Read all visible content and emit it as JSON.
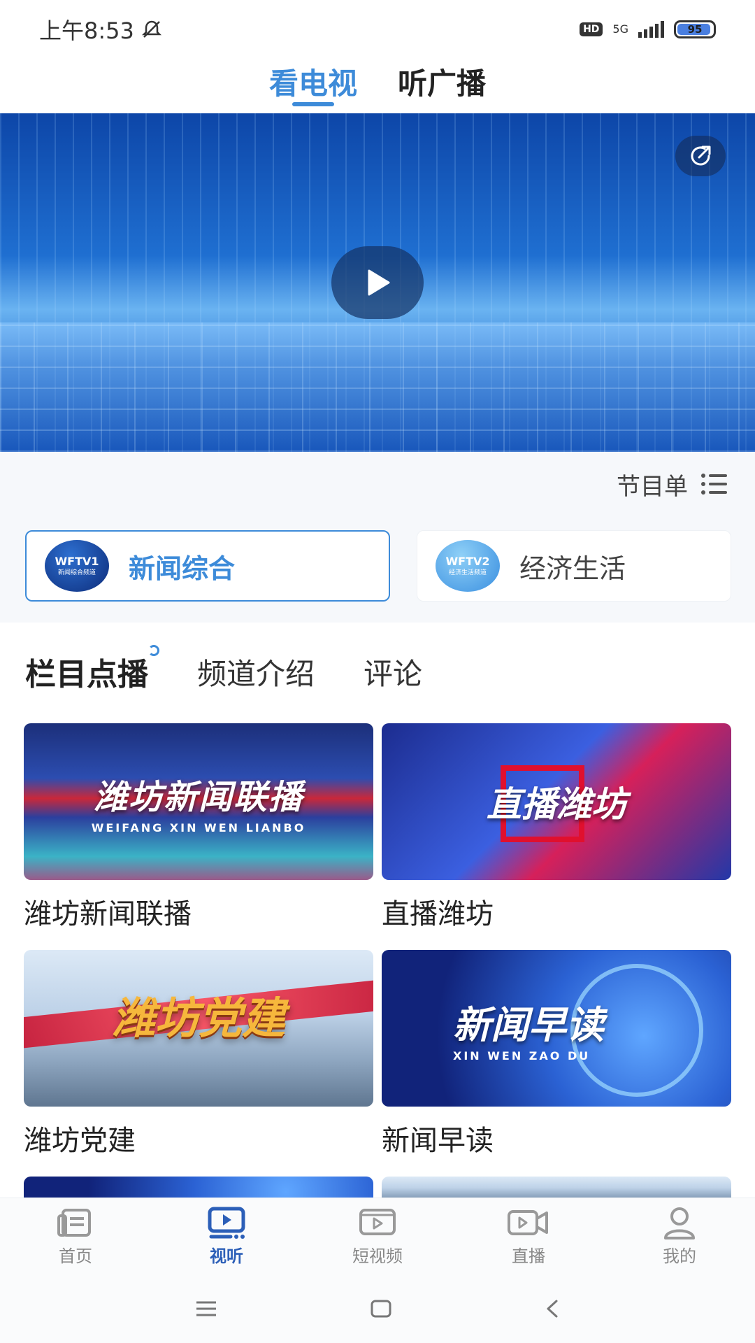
{
  "status_bar": {
    "time": "上午8:53",
    "hd": "HD",
    "network": "5G",
    "battery": "95",
    "battery_level": 0.95
  },
  "top_tabs": [
    {
      "label": "看电视",
      "active": true
    },
    {
      "label": "听广播",
      "active": false
    }
  ],
  "player": {
    "share_icon": "share-icon",
    "play_icon": "play-icon"
  },
  "schedule": {
    "label": "节目单",
    "icon": "list-icon"
  },
  "channels": [
    {
      "name": "新闻综合",
      "logo_text": "WFTV",
      "logo_number": "1",
      "logo_sub": "新闻综合频道",
      "active": true
    },
    {
      "name": "经济生活",
      "logo_text": "WFTV",
      "logo_number": "2",
      "logo_sub": "经济生活频道",
      "active": false
    }
  ],
  "section_tabs": [
    {
      "label": "栏目点播",
      "active": true
    },
    {
      "label": "频道介绍",
      "active": false
    },
    {
      "label": "评论",
      "active": false
    }
  ],
  "programs": [
    {
      "title": "潍坊新闻联播",
      "thumb_text": "潍坊新闻联播",
      "thumb_sub": "WEIFANG XIN WEN LIANBO"
    },
    {
      "title": "直播潍坊",
      "thumb_text": "直播潍坊",
      "thumb_sub": ""
    },
    {
      "title": "潍坊党建",
      "thumb_text": "潍坊党建",
      "thumb_sub": ""
    },
    {
      "title": "新闻早读",
      "thumb_text": "新闻早读",
      "thumb_sub": "XIN WEN ZAO DU"
    }
  ],
  "bottom_nav": [
    {
      "label": "首页",
      "icon": "home-icon",
      "active": false
    },
    {
      "label": "视听",
      "icon": "audio-video-icon",
      "active": true
    },
    {
      "label": "短视频",
      "icon": "short-video-icon",
      "active": false
    },
    {
      "label": "直播",
      "icon": "live-camera-icon",
      "active": false
    },
    {
      "label": "我的",
      "icon": "user-icon",
      "active": false
    }
  ],
  "system_nav": {
    "menu_icon": "menu-icon",
    "home_icon": "home-square-icon",
    "back_icon": "back-icon"
  }
}
